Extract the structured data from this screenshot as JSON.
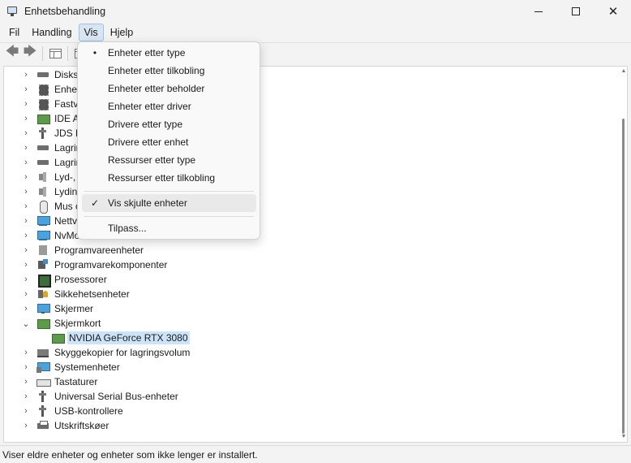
{
  "window": {
    "title": "Enhetsbehandling"
  },
  "menubar": [
    "Fil",
    "Handling",
    "Vis",
    "Hjelp"
  ],
  "tree": [
    {
      "label": "Diskst",
      "icon": "disk-icon",
      "expanded": false
    },
    {
      "label": "Enhet",
      "icon": "chip-icon",
      "expanded": false
    },
    {
      "label": "Fastva",
      "icon": "chip-icon",
      "expanded": false
    },
    {
      "label": "IDE AT",
      "icon": "card-icon",
      "expanded": false
    },
    {
      "label": "JDS La",
      "icon": "usb-icon",
      "expanded": false
    },
    {
      "label": "Lagrin",
      "icon": "disk-icon",
      "expanded": false
    },
    {
      "label": "Lagrin",
      "icon": "disk-icon",
      "expanded": false
    },
    {
      "label": "Lyd-, v",
      "icon": "speaker-icon",
      "expanded": false
    },
    {
      "label": "Lydinn",
      "icon": "speaker-icon",
      "expanded": false
    },
    {
      "label": "Mus o",
      "icon": "mouse-icon",
      "expanded": false
    },
    {
      "label": "Nettve",
      "icon": "network-icon",
      "expanded": false
    },
    {
      "label": "NvMo",
      "icon": "network-icon",
      "expanded": false
    },
    {
      "label": "Programvareenheter",
      "icon": "software-icon",
      "expanded": false
    },
    {
      "label": "Programvarekomponenter",
      "icon": "puzzle-icon",
      "expanded": false
    },
    {
      "label": "Prosessorer",
      "icon": "cpu-icon",
      "expanded": false
    },
    {
      "label": "Sikkehetsenheter",
      "icon": "security-icon",
      "expanded": false
    },
    {
      "label": "Skjermer",
      "icon": "monitor-icon",
      "expanded": false
    },
    {
      "label": "Skjermkort",
      "icon": "display-adapter-icon",
      "expanded": true
    },
    {
      "label": "NVIDIA GeForce RTX 3080",
      "icon": "display-adapter-icon",
      "child": true,
      "selected": true
    },
    {
      "label": "Skyggekopier for lagringsvolum",
      "icon": "shadow-copy-icon",
      "expanded": false
    },
    {
      "label": "Systemenheter",
      "icon": "system-devices-icon",
      "expanded": false
    },
    {
      "label": "Tastaturer",
      "icon": "keyboard-icon",
      "expanded": false
    },
    {
      "label": "Universal Serial Bus-enheter",
      "icon": "usb-icon",
      "expanded": false
    },
    {
      "label": "USB-kontrollere",
      "icon": "usb-icon",
      "expanded": false
    },
    {
      "label": "Utskriftskøer",
      "icon": "printer-icon",
      "expanded": false
    }
  ],
  "vis_menu": {
    "items": [
      {
        "label": "Enheter etter type",
        "mark": "•"
      },
      {
        "label": "Enheter etter tilkobling",
        "mark": ""
      },
      {
        "label": "Enheter etter beholder",
        "mark": ""
      },
      {
        "label": "Enheter etter driver",
        "mark": ""
      },
      {
        "label": "Drivere etter type",
        "mark": ""
      },
      {
        "label": "Drivere etter enhet",
        "mark": ""
      },
      {
        "label": "Ressurser etter type",
        "mark": ""
      },
      {
        "label": "Ressurser etter tilkobling",
        "mark": ""
      }
    ],
    "toggle": {
      "label": "Vis skjulte enheter",
      "mark": "✓"
    },
    "customize": {
      "label": "Tilpass..."
    }
  },
  "status": {
    "text": "Viser eldre enheter og enheter som ikke lenger er installert."
  }
}
